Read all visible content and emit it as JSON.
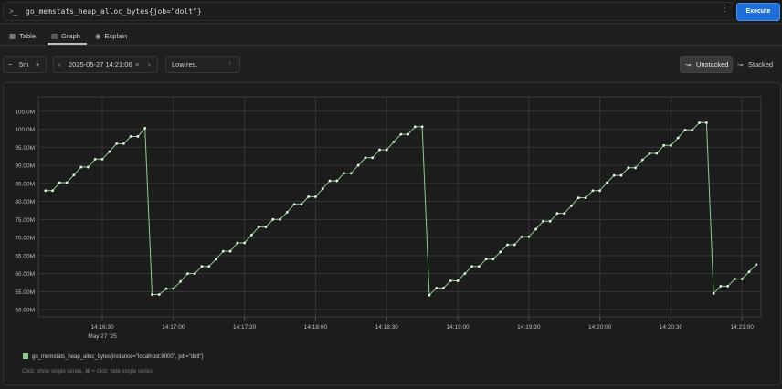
{
  "query_bar": {
    "prompt_icon": "terminal-prompt-icon",
    "expression": "go_memstats_heap_alloc_bytes{job=\"dolt\"}",
    "menu_icon": "kebab-menu-icon",
    "execute_label": "Execute"
  },
  "tabs": [
    {
      "label": "Table",
      "icon": "table-icon",
      "active": false
    },
    {
      "label": "Graph",
      "icon": "graph-icon",
      "active": true
    },
    {
      "label": "Explain",
      "icon": "explain-icon",
      "active": false
    }
  ],
  "controls": {
    "range": "5m",
    "minus_icon": "minus-icon",
    "plus_icon": "plus-icon",
    "end_time": "2025-05-27 14:21:06",
    "resolution": "Low res.",
    "unstacked_label": "Unstacked",
    "stacked_label": "Stacked",
    "stacking_mode": "unstacked"
  },
  "chart_data": {
    "type": "line",
    "y_tick_labels": [
      "50.00M",
      "55.00M",
      "60.00M",
      "65.00M",
      "70.00M",
      "75.00M",
      "80.00M",
      "85.00M",
      "90.00M",
      "95.00M",
      "100.0M",
      "105.0M"
    ],
    "y_ticks": [
      50,
      55,
      60,
      65,
      70,
      75,
      80,
      85,
      90,
      95,
      100,
      105
    ],
    "ylim": [
      48,
      109
    ],
    "x_tick_labels": [
      "14:16:30",
      "14:17:00",
      "14:17:30",
      "14:18:00",
      "14:18:30",
      "14:19:00",
      "14:19:30",
      "14:20:00",
      "14:20:30",
      "14:21:00"
    ],
    "x_ticks": [
      30,
      60,
      90,
      120,
      150,
      180,
      210,
      240,
      270,
      300
    ],
    "x_date_label": "May 27 '25",
    "xlim": [
      3,
      308
    ],
    "series": [
      {
        "name": "go_memstats_heap_alloc_bytes{instance=\"localhost:8000\", job=\"dolt\"}",
        "color": "#8ccd8c",
        "x": [
          6,
          9,
          12,
          15,
          18,
          21,
          24,
          27,
          30,
          33,
          36,
          39,
          42,
          45,
          48,
          51,
          54,
          57,
          60,
          63,
          66,
          69,
          72,
          75,
          78,
          81,
          84,
          87,
          90,
          93,
          96,
          99,
          102,
          105,
          108,
          111,
          114,
          117,
          120,
          123,
          126,
          129,
          132,
          135,
          138,
          141,
          144,
          147,
          150,
          153,
          156,
          159,
          162,
          165,
          168,
          171,
          174,
          177,
          180,
          183,
          186,
          189,
          192,
          195,
          198,
          201,
          204,
          207,
          210,
          213,
          216,
          219,
          222,
          225,
          228,
          231,
          234,
          237,
          240,
          243,
          246,
          249,
          252,
          255,
          258,
          261,
          264,
          267,
          270,
          273,
          276,
          279,
          282,
          285,
          288,
          291,
          294,
          297,
          300,
          303,
          306
        ],
        "values": [
          83,
          83,
          85.2,
          85.2,
          87.3,
          89.5,
          89.5,
          91.7,
          91.7,
          93.8,
          96,
          96,
          98,
          98,
          100.3,
          54.2,
          54.2,
          55.8,
          55.8,
          57.8,
          60,
          60,
          62,
          62,
          64,
          66.2,
          66.2,
          68.5,
          68.5,
          70.7,
          72.9,
          72.9,
          75,
          75,
          77,
          79.2,
          79.2,
          81.3,
          81.3,
          83.5,
          85.7,
          85.7,
          87.8,
          87.8,
          90,
          92.1,
          92.1,
          94.3,
          94.3,
          96.5,
          98.6,
          98.6,
          100.7,
          100.7,
          54,
          56,
          56,
          58,
          58,
          60,
          62,
          62,
          64,
          64,
          66,
          68,
          68,
          70.2,
          70.2,
          72.3,
          74.5,
          74.5,
          76.7,
          76.7,
          78.8,
          81,
          81,
          83,
          83,
          85.2,
          87.2,
          87.2,
          89.3,
          89.3,
          91.5,
          93.3,
          93.3,
          95.5,
          95.5,
          97.6,
          99.8,
          99.8,
          101.8,
          101.8,
          54.5,
          56.5,
          56.5,
          58.5,
          58.5,
          60.5,
          62.5
        ]
      }
    ],
    "grid": true
  },
  "legend_hint": "Click: show single series, ⌘ + click: hide single series"
}
